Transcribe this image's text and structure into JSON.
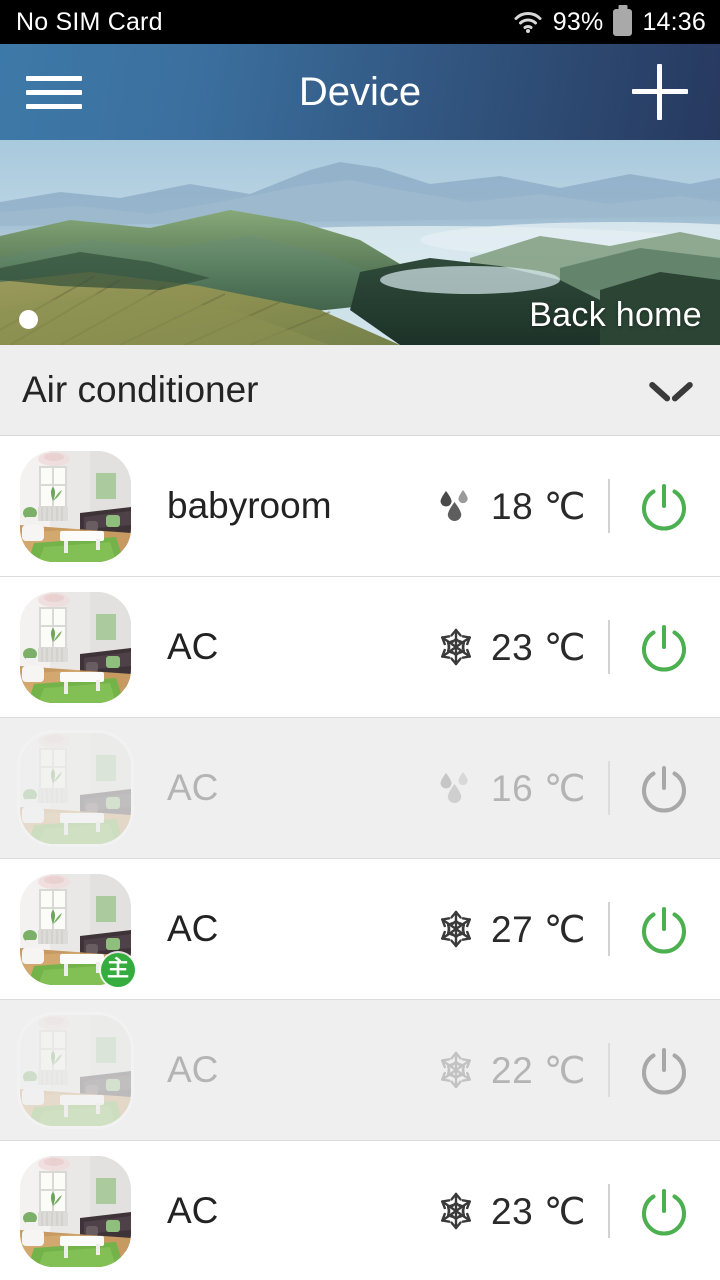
{
  "status_bar": {
    "carrier": "No SIM Card",
    "wifi_icon": "wifi-icon",
    "battery_percent": "93%",
    "battery_icon": "battery-icon",
    "time": "14:36"
  },
  "app_bar": {
    "menu_icon": "hamburger-menu-icon",
    "title": "Device",
    "add_icon": "plus-icon"
  },
  "hero": {
    "label": "Back home",
    "page_indicator_count": 1,
    "active_page": 1
  },
  "section": {
    "title": "Air conditioner",
    "expand_icon": "chevron-down-icon"
  },
  "devices": [
    {
      "name": "babyroom",
      "mode_icon": "water-drop-icon",
      "mode": "dehumidify",
      "temperature": "18 ℃",
      "power_icon": "power-icon",
      "power_state": "on",
      "online": true,
      "badge": null
    },
    {
      "name": "AC",
      "mode_icon": "snowflake-icon",
      "mode": "cool",
      "temperature": "23 ℃",
      "power_icon": "power-icon",
      "power_state": "on",
      "online": true,
      "badge": null
    },
    {
      "name": "AC",
      "mode_icon": "water-drop-icon",
      "mode": "dehumidify",
      "temperature": "16 ℃",
      "power_icon": "power-icon",
      "power_state": "off",
      "online": false,
      "badge": null
    },
    {
      "name": "AC",
      "mode_icon": "snowflake-icon",
      "mode": "cool",
      "temperature": "27 ℃",
      "power_icon": "power-icon",
      "power_state": "on",
      "online": true,
      "badge": "主"
    },
    {
      "name": "AC",
      "mode_icon": "snowflake-icon",
      "mode": "cool",
      "temperature": "22 ℃",
      "power_icon": "power-icon",
      "power_state": "off",
      "online": false,
      "badge": null
    },
    {
      "name": "AC",
      "mode_icon": "snowflake-icon",
      "mode": "cool",
      "temperature": "23 ℃",
      "power_icon": "power-icon",
      "power_state": "on",
      "online": true,
      "badge": null
    }
  ],
  "colors": {
    "status_bar_bg": "#000000",
    "app_bar_gradient_start": "#3d79a8",
    "app_bar_gradient_end": "#27395f",
    "power_on": "#4caf50",
    "power_off": "#a8a8a8",
    "badge_green": "#34ad3e",
    "section_bg": "#eeeeee",
    "offline_row_bg": "#efefef"
  }
}
